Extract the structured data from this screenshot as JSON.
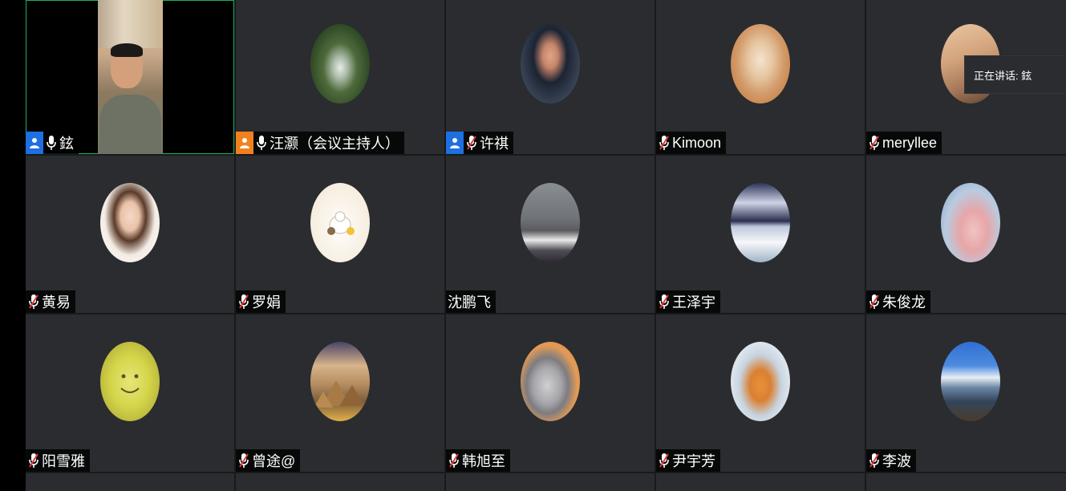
{
  "speaking_toast": "正在讲话: 鉉",
  "colors": {
    "tile_bg": "#2a2c30",
    "active_border": "#19b35f",
    "cohost_badge": "#1e6fe0",
    "host_badge": "#f0821e",
    "muted_slash": "#e23a3a"
  },
  "participants": [
    {
      "name": "鉉",
      "role": "cohost",
      "mic": "on",
      "video": true
    },
    {
      "name": "汪灏（会议主持人）",
      "role": "host",
      "mic": "on",
      "avatar": "waterfall"
    },
    {
      "name": "许祺",
      "role": "cohost",
      "mic": "muted",
      "avatar": "man-with-cameras"
    },
    {
      "name": "Kimoon",
      "role": "",
      "mic": "muted",
      "avatar": "cat"
    },
    {
      "name": "meryllee",
      "role": "",
      "mic": "muted",
      "avatar": "desert"
    },
    {
      "name": "黄易",
      "role": "",
      "mic": "muted",
      "avatar": "woman-portrait"
    },
    {
      "name": "罗娟",
      "role": "",
      "mic": "muted",
      "avatar": "cartoon-sheep"
    },
    {
      "name": "沈鹏飞",
      "role": "",
      "mic": "none",
      "avatar": "city-view"
    },
    {
      "name": "王泽宇",
      "role": "",
      "mic": "muted",
      "avatar": "anime-faces"
    },
    {
      "name": "朱俊龙",
      "role": "",
      "mic": "muted",
      "avatar": "pig"
    },
    {
      "name": "阳雪雅",
      "role": "",
      "mic": "muted",
      "avatar": "smiley-face"
    },
    {
      "name": "曾途@",
      "role": "",
      "mic": "muted",
      "avatar": "pyramids"
    },
    {
      "name": "韩旭至",
      "role": "",
      "mic": "muted",
      "avatar": "rabbit"
    },
    {
      "name": "尹宇芳",
      "role": "",
      "mic": "muted",
      "avatar": "orange-cat"
    },
    {
      "name": "李波",
      "role": "",
      "mic": "muted",
      "avatar": "mountains"
    }
  ]
}
